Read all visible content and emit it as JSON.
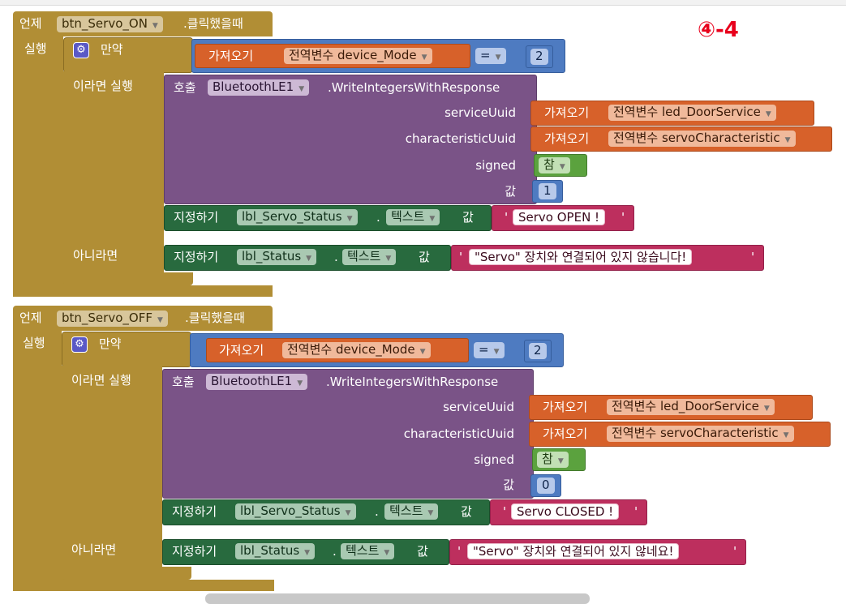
{
  "annotation": "④-4",
  "blocks": [
    {
      "event_prefix": "언제",
      "component": "btn_Servo_ON",
      "event_suffix": ".클릭했을때",
      "do_label": "실행",
      "if_label": "만약",
      "get_label": "가져오기",
      "global_var_mode": "전역변수 device_Mode",
      "operator": "=",
      "compare_value": "2",
      "then_label": "이라면 실행",
      "call_label": "호출",
      "ble_component": "BluetoothLE1",
      "method": ".WriteIntegersWithResponse",
      "param_service": "serviceUuid",
      "param_characteristic": "characteristicUuid",
      "param_signed": "signed",
      "param_value": "값",
      "global_var_service": "전역변수 led_DoorService",
      "global_var_characteristic": "전역변수 servoCharacteristic",
      "signed_value": "참",
      "write_value": "1",
      "set_label": "지정하기",
      "status_component": "lbl_Servo_Status",
      "dot": ".",
      "text_prop": "텍스트",
      "to_label": "값",
      "status_text": "Servo OPEN !",
      "else_label": "아니라면",
      "else_component": "lbl_Status",
      "else_text": "\"Servo\" 장치와 연결되어 있지 않습니다!",
      "quote": "'"
    },
    {
      "event_prefix": "언제",
      "component": "btn_Servo_OFF",
      "event_suffix": ".클릭했을때",
      "do_label": "실행",
      "if_label": "만약",
      "get_label": "가져오기",
      "global_var_mode": "전역변수 device_Mode",
      "operator": "=",
      "compare_value": "2",
      "then_label": "이라면 실행",
      "call_label": "호출",
      "ble_component": "BluetoothLE1",
      "method": ".WriteIntegersWithResponse",
      "param_service": "serviceUuid",
      "param_characteristic": "characteristicUuid",
      "param_signed": "signed",
      "param_value": "값",
      "global_var_service": "전역변수 led_DoorService",
      "global_var_characteristic": "전역변수 servoCharacteristic",
      "signed_value": "참",
      "write_value": "0",
      "set_label": "지정하기",
      "status_component": "lbl_Servo_Status",
      "dot": ".",
      "text_prop": "텍스트",
      "to_label": "값",
      "status_text": "Servo CLOSED !",
      "else_label": "아니라면",
      "else_component": "lbl_Status",
      "else_text": "\"Servo\" 장치와 연결되어 있지 않네요!",
      "quote": "'"
    }
  ],
  "colors": {
    "event": "#b18e35",
    "logic_compare": "#4e7bc1",
    "variable": "#d7612a",
    "procedure_call": "#7a5387",
    "setter": "#286a3e",
    "boolean": "#5ba23e",
    "text": "#bd2f5e",
    "annotation": "#e8001c"
  },
  "icons": {
    "mutator": "gear-icon",
    "dropdown": "dropdown-arrow-icon"
  }
}
